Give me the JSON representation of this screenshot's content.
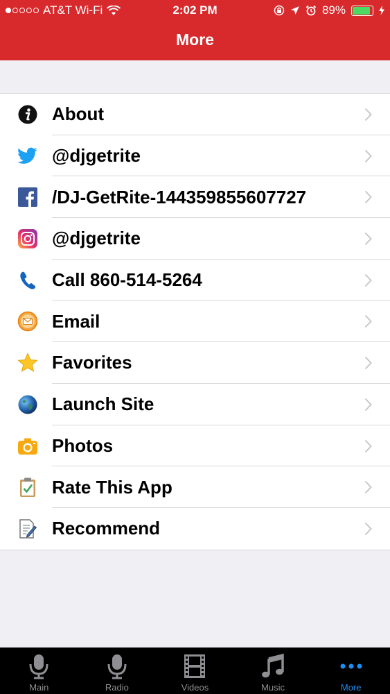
{
  "status_bar": {
    "carrier": "AT&T Wi-Fi",
    "time": "2:02 PM",
    "battery": "89%"
  },
  "nav": {
    "title": "More"
  },
  "menu": {
    "items": [
      {
        "label": "About",
        "icon": "info-icon"
      },
      {
        "label": "@djgetrite",
        "icon": "twitter-icon"
      },
      {
        "label": "/DJ-GetRite-144359855607727",
        "icon": "facebook-icon"
      },
      {
        "label": "@djgetrite",
        "icon": "instagram-icon"
      },
      {
        "label": "Call 860-514-5264",
        "icon": "phone-icon"
      },
      {
        "label": "Email",
        "icon": "email-icon"
      },
      {
        "label": "Favorites",
        "icon": "star-icon"
      },
      {
        "label": "Launch Site",
        "icon": "globe-icon"
      },
      {
        "label": "Photos",
        "icon": "camera-icon"
      },
      {
        "label": "Rate This App",
        "icon": "clipboard-check-icon"
      },
      {
        "label": "Recommend",
        "icon": "document-pencil-icon"
      }
    ]
  },
  "tabbar": {
    "tabs": [
      {
        "label": "Main",
        "icon": "microphone-icon"
      },
      {
        "label": "Radio",
        "icon": "microphone-icon"
      },
      {
        "label": "Videos",
        "icon": "film-icon"
      },
      {
        "label": "Music",
        "icon": "music-note-icon"
      },
      {
        "label": "More",
        "icon": "more-dots-icon"
      }
    ],
    "active": "More"
  },
  "colors": {
    "header": "#d8292c",
    "tab_active": "#1b8ef4",
    "tab_inactive": "#8e8e93",
    "chevron": "#c7c7cc"
  }
}
